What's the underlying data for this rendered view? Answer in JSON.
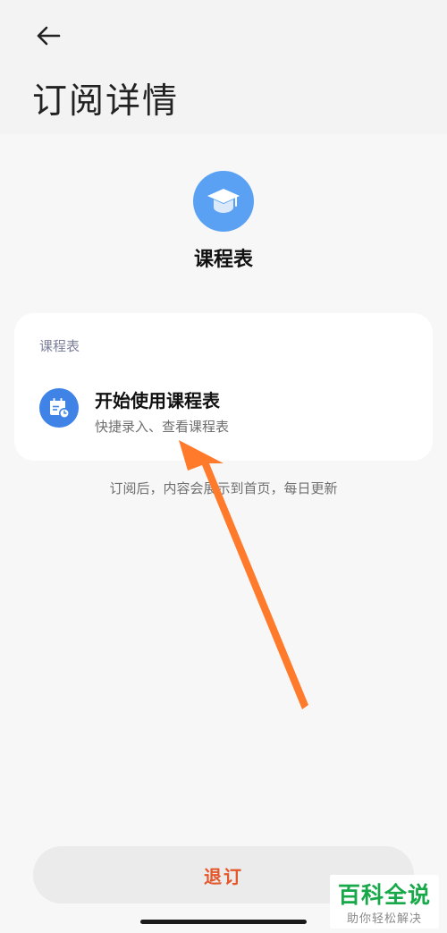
{
  "header": {
    "title": "订阅详情",
    "back_icon": "arrow-left-icon"
  },
  "app": {
    "name": "课程表",
    "icon": "graduation-cap-icon",
    "icon_color": "#5aa1f3"
  },
  "card": {
    "header": "课程表",
    "item": {
      "title": "开始使用课程表",
      "subtitle": "快捷录入、查看课程表",
      "icon": "calendar-clock-icon",
      "icon_color": "#3f83e6"
    }
  },
  "note": "订阅后，内容会展示到首页，每日更新",
  "footer": {
    "unsubscribe_label": "退订",
    "unsubscribe_color": "#e4572a"
  },
  "overlay": {
    "annotation_arrow_color": "#ff7a2a"
  },
  "watermark": {
    "title": "百科全说",
    "subtitle": "助你轻松解决"
  }
}
